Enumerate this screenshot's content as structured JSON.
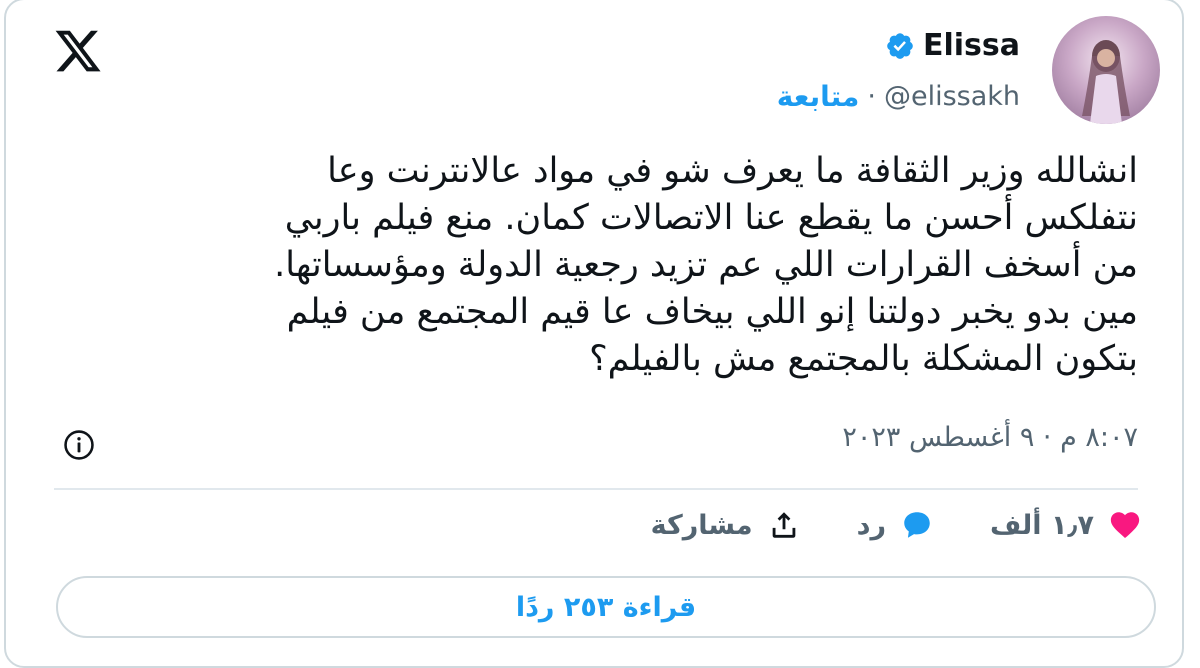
{
  "author": {
    "display_name": "Elissa",
    "handle": "@elissakh",
    "follow_label": "متابعة",
    "separator": "·"
  },
  "tweet": {
    "lines": [
      "انشالله وزير الثقافة ما يعرف شو في مواد عالانترنت وعا",
      "نتفلكس أحسن ما يقطع عنا الاتصالات كمان. منع فيلم باربي",
      "من أسخف القرارات اللي عم تزيد رجعية الدولة ومؤسساتها.",
      "مين بدو يخبر دولتنا إنو اللي بيخاف عا قيم المجتمع من فيلم",
      "بتكون المشكلة بالمجتمع مش بالفيلم؟"
    ],
    "timestamp": "٨:٠٧ م · ٩ أغسطس ٢٠٢٣"
  },
  "actions": {
    "like_count": "١٫٧ ألف",
    "reply_label": "رد",
    "share_label": "مشاركة"
  },
  "read_replies_label": "قراءة ٢٥٣ ردًا",
  "colors": {
    "accent": "#1d9bf0",
    "like": "#f91880",
    "muted": "#536471",
    "border": "#cfd9de"
  },
  "icons": {
    "brand": "x-logo-icon",
    "verified": "verified-badge-icon",
    "info": "info-icon",
    "like": "heart-icon",
    "reply": "speech-bubble-icon",
    "share": "share-upload-icon"
  }
}
